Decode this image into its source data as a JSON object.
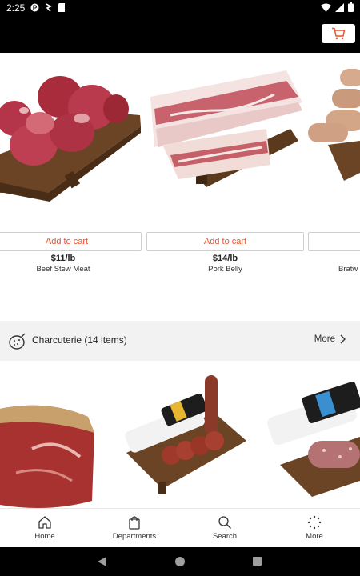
{
  "status": {
    "time": "2:25"
  },
  "products": [
    {
      "name": "Beef Stew Meat",
      "price": "$11/lb",
      "add_label": "Add to cart"
    },
    {
      "name": "Pork Belly",
      "price": "$14/lb",
      "add_label": "Add to cart"
    },
    {
      "name": "Bratw",
      "price": "",
      "add_label": ""
    }
  ],
  "section": {
    "title": "Charcuterie (14 items)",
    "more_label": "More"
  },
  "nav": [
    {
      "label": "Home",
      "icon": "home-icon"
    },
    {
      "label": "Departments",
      "icon": "bag-icon"
    },
    {
      "label": "Search",
      "icon": "search-icon"
    },
    {
      "label": "More",
      "icon": "dots-icon"
    }
  ],
  "colors": {
    "accent": "#e8522c",
    "section_bg": "#f2f2f2"
  }
}
